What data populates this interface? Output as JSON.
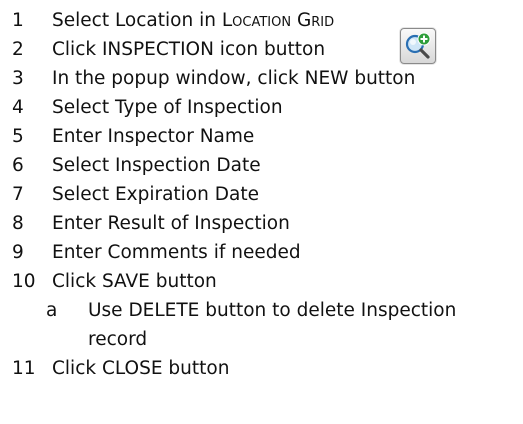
{
  "steps": [
    {
      "num": "1",
      "text_main": "Select Location in ",
      "text_sc": "Location Grid"
    },
    {
      "num": "2",
      "text": "Click INSPECTION icon button"
    },
    {
      "num": "3",
      "text": "In the popup window, click NEW button"
    },
    {
      "num": "4",
      "text": "Select Type of Inspection"
    },
    {
      "num": "5",
      "text": "Enter Inspector Name"
    },
    {
      "num": "6",
      "text": "Select Inspection Date"
    },
    {
      "num": "7",
      "text": "Select Expiration Date"
    },
    {
      "num": "8",
      "text": "Enter Result of Inspection"
    },
    {
      "num": "9",
      "text": "Enter Comments if needed"
    },
    {
      "num": "10",
      "text": "Click SAVE button"
    },
    {
      "num": "a",
      "text": "Use DELETE button to delete Inspection",
      "text_cont": "record"
    },
    {
      "num": "11",
      "text": "Click CLOSE button"
    }
  ],
  "icon": {
    "name": "inspection-add-icon",
    "accent": "#2e9e3a",
    "lens": "#2a6fb3"
  }
}
